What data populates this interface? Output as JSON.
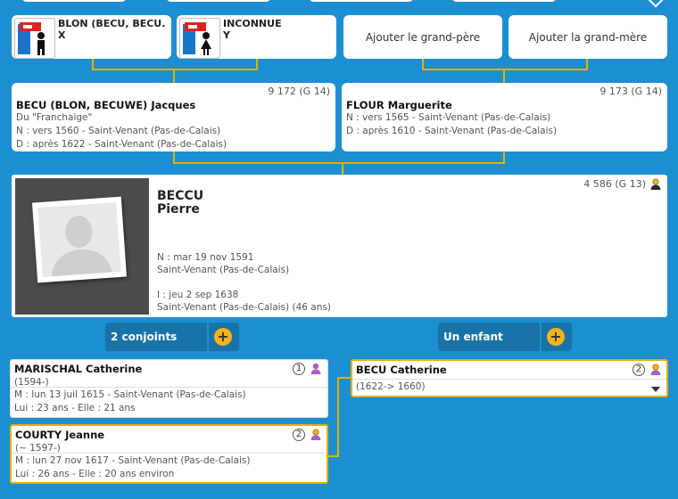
{
  "grandparents": {
    "gf": {
      "name": "BLON (BECU, BECU...",
      "marker": "X"
    },
    "gm": {
      "name": "INCONNUE",
      "marker": "Y"
    },
    "add_grandfather": "Ajouter le grand-père",
    "add_grandmother": "Ajouter la grand-mère"
  },
  "father": {
    "number": "9 172 (G 14)",
    "name": "BECU (BLON, BECUWE) Jacques",
    "nickname": "Du \"Franchaige\"",
    "birth": "N : vers 1560 - Saint-Venant (Pas-de-Calais)",
    "death": "D : après 1622 - Saint-Venant (Pas-de-Calais)"
  },
  "mother": {
    "number": "9 173 (G 14)",
    "name": "FLOUR Marguerite",
    "birth": "N : vers 1565 - Saint-Venant (Pas-de-Calais)",
    "death": "D : après 1610 - Saint-Venant (Pas-de-Calais)"
  },
  "person": {
    "number": "4 586 (G 13)",
    "last_name": "BECCU",
    "first_name": "Pierre",
    "birth_date": "N : mar 19 nov 1591",
    "birth_place": "Saint-Venant (Pas-de-Calais)",
    "inhum_date": "I : jeu 2 sep 1638",
    "inhum_place": "Saint-Venant (Pas-de-Calais) (46 ans)"
  },
  "buttons": {
    "spouses": "2 conjoints",
    "children": "Un enfant"
  },
  "spouses": [
    {
      "name": "MARISCHAL Catherine",
      "dates": "(1594-)",
      "badge": "1",
      "marriage": "M : lun 13 juil 1615 - Saint-Venant (Pas-de-Calais)",
      "ages": "Lui : 23 ans - Elle : 21 ans"
    },
    {
      "name": "COURTY Jeanne",
      "dates": "(~ 1597-)",
      "badge": "2",
      "marriage": "M : lun 27 nov 1617 - Saint-Venant (Pas-de-Calais)",
      "ages": "Lui : 26 ans - Elle : 20 ans environ"
    }
  ],
  "child": {
    "name": "BECU Catherine",
    "dates": "(1622-> 1660)",
    "badge": "2"
  },
  "colors": {
    "background": "#1b8fd1",
    "accent": "#e8b000",
    "button": "#1a73a8",
    "plus": "#f2b418",
    "male": "#f2b418",
    "female": "#b05bc9"
  }
}
